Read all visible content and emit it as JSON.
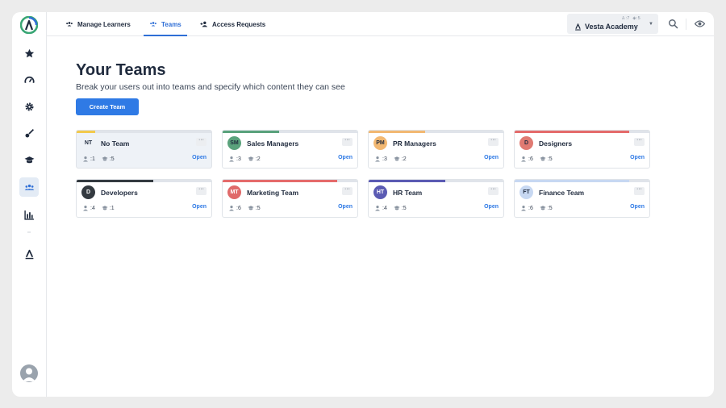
{
  "nav": {
    "tabs": [
      {
        "label": "Manage Learners"
      },
      {
        "label": "Teams"
      },
      {
        "label": "Access Requests"
      }
    ]
  },
  "org": {
    "name": "Vesta Academy",
    "learners": ":7",
    "courses": ":5"
  },
  "page": {
    "title": "Your Teams",
    "subtitle": "Break your users out into teams and specify which content they can see",
    "create_button": "Create Team"
  },
  "teams": [
    {
      "initials": "NT",
      "name": "No Team",
      "learners": ":1",
      "courses": ":5",
      "open": "Open",
      "color": "#f2c94c",
      "fill": 0.14,
      "badge_bg": "transparent",
      "badge_fg": "#1f2a3d"
    },
    {
      "initials": "SM",
      "name": "Sales Managers",
      "learners": ":3",
      "courses": ":2",
      "open": "Open",
      "color": "#5aa27c",
      "fill": 0.42,
      "badge_bg": "#5aa27c",
      "badge_fg": "#1f2a3d"
    },
    {
      "initials": "PM",
      "name": "PR Managers",
      "learners": ":3",
      "courses": ":2",
      "open": "Open",
      "color": "#f2b872",
      "fill": 0.42,
      "badge_bg": "#f2b872",
      "badge_fg": "#1f2a3d"
    },
    {
      "initials": "D",
      "name": "Designers",
      "learners": ":6",
      "courses": ":5",
      "open": "Open",
      "color": "#e56b6b",
      "fill": 0.85,
      "badge_bg": "#e07a72",
      "badge_fg": "#1f2a3d"
    },
    {
      "initials": "D",
      "name": "Developers",
      "learners": ":4",
      "courses": ":1",
      "open": "Open",
      "color": "#343a40",
      "fill": 0.57,
      "badge_bg": "#343a40",
      "badge_fg": "#ffffff"
    },
    {
      "initials": "MT",
      "name": "Marketing Team",
      "learners": ":6",
      "courses": ":5",
      "open": "Open",
      "color": "#e56b6b",
      "fill": 0.85,
      "badge_bg": "#e06a6a",
      "badge_fg": "#ffffff"
    },
    {
      "initials": "HT",
      "name": "HR Team",
      "learners": ":4",
      "courses": ":5",
      "open": "Open",
      "color": "#5b5bb3",
      "fill": 0.57,
      "badge_bg": "#5b5bb3",
      "badge_fg": "#ffffff"
    },
    {
      "initials": "FT",
      "name": "Finance Team",
      "learners": ":6",
      "courses": ":5",
      "open": "Open",
      "color": "#c7d8f2",
      "fill": 0.85,
      "badge_bg": "#c7d8f2",
      "badge_fg": "#1f2a3d"
    }
  ],
  "colors": {
    "accent": "#2f7ae5",
    "brand": "#2f6fd6"
  }
}
